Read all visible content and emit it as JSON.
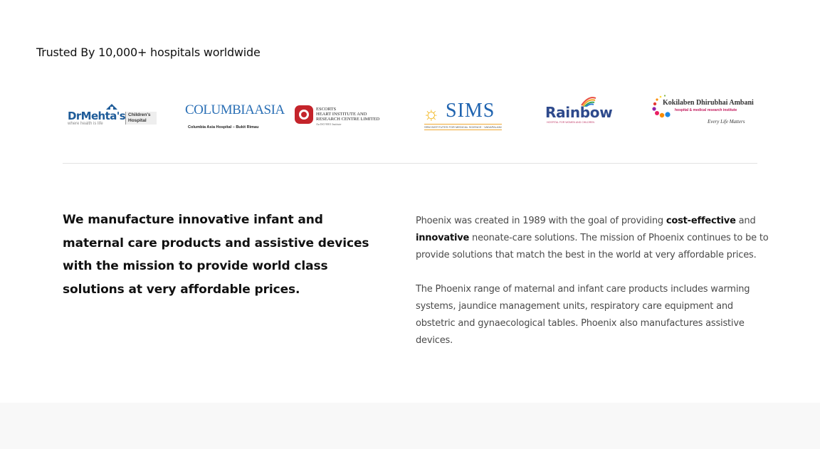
{
  "trusted": {
    "heading": "Trusted By 10,000+ hospitals worldwide"
  },
  "logos": {
    "mehta": {
      "name": "DrMehta's",
      "box": "Children's Hospital",
      "tagline": "where health is life"
    },
    "columbia": {
      "name": "COLUMBIAASIA",
      "sub": "Columbia Asia Hospital – Bukit Rimau"
    },
    "escorts": {
      "line1": "ESCORTS",
      "line2": "HEART INSTITUTE AND",
      "line3": "RESEARCH CENTRE LIMITED",
      "line4": "An ISO 9001 Institute"
    },
    "sims": {
      "name": "SIMS",
      "sub": "SRM INSTITUTES FOR MEDICAL SCIENCE · VADAPALANI"
    },
    "rainbow": {
      "name": "Rainbow",
      "sub": "HOSPITAL FOR WOMEN AND CHILDREN"
    },
    "kokilaben": {
      "name": "Kokilaben Dhirubhai Ambani",
      "sub": "hospital & medical research institute",
      "tagline": "Every Life Matters"
    }
  },
  "mission": {
    "headline": "We manufacture innovative infant and maternal care products and assistive devices with the mission to provide world class solutions at very affordable prices."
  },
  "about": {
    "p1_a": "Phoenix was created in 1989 with the goal of providing ",
    "p1_b": "cost-effective",
    "p1_c": " and ",
    "p1_d": "innovative",
    "p1_e": " neonate-care solutions. The mission of Phoenix continues to be to provide solutions that match the best in the world at very affordable prices.",
    "p2": "The Phoenix range of maternal and infant care products includes warming systems, jaundice management units, respiratory care equipment and obstetric and gynaecological tables. Phoenix also manufactures assistive devices."
  }
}
